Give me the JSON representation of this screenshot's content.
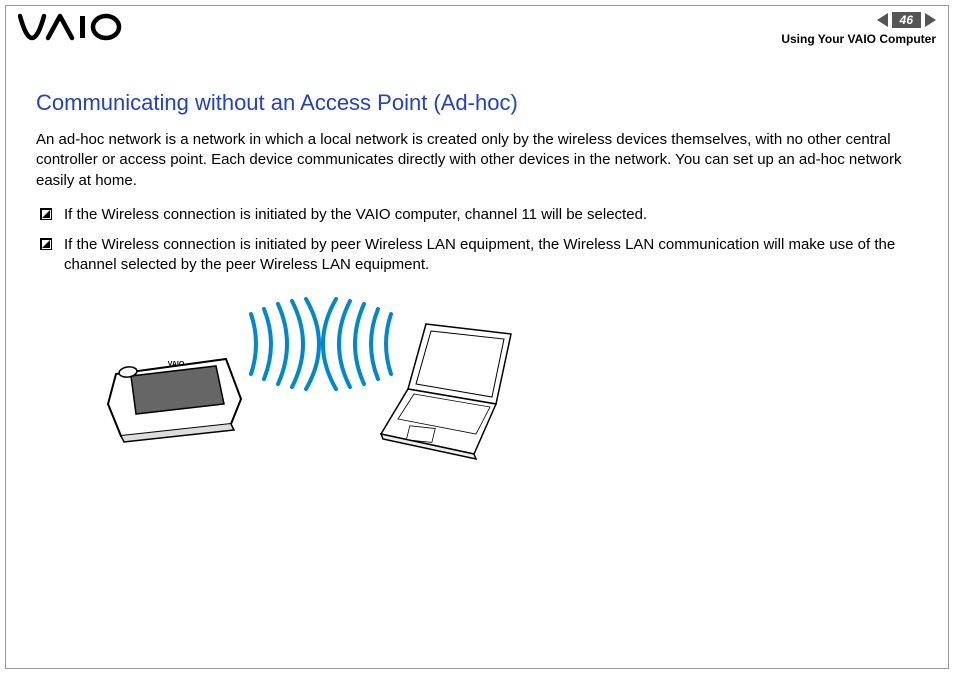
{
  "header": {
    "logo_text": "VAIO",
    "page_number": "46",
    "section_label": "Using Your VAIO Computer"
  },
  "content": {
    "title": "Communicating without an Access Point (Ad-hoc)",
    "intro": "An ad-hoc network is a network in which a local network is created only by the wireless devices themselves, with no other central controller or access point. Each device communicates directly with other devices in the network. You can set up an ad-hoc network easily at home.",
    "bullets": [
      "If the Wireless connection is initiated by the VAIO computer, channel 11 will be selected.",
      "If the Wireless connection is initiated by peer Wireless LAN equipment, the Wireless LAN communication will make use of the channel selected by the peer Wireless LAN equipment."
    ]
  }
}
